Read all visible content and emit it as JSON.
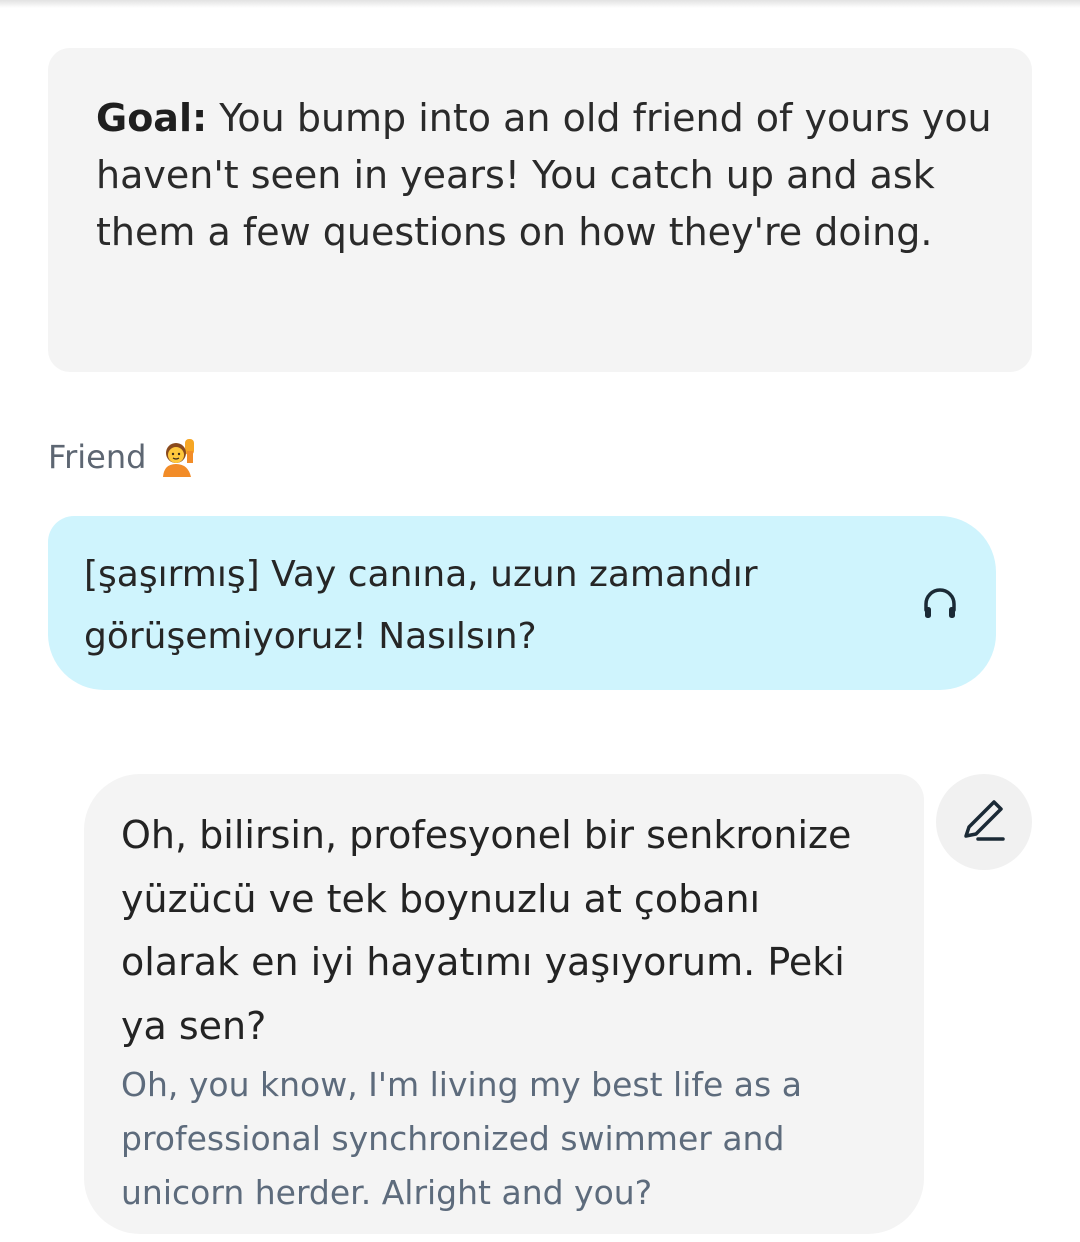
{
  "goal": {
    "label": "Goal:",
    "text": " You bump into an old friend of yours you haven't seen in years! You catch up and ask them a few questions on how they're doing."
  },
  "speaker": {
    "name": "Friend",
    "avatar_icon": "person-raising-hand-icon"
  },
  "friend_message": {
    "text": "[şaşırmış] Vay canına, uzun zamandır görüşemiyoruz! Nasılsın?",
    "listen_icon": "headphones-icon"
  },
  "reply": {
    "text": "Oh, bilirsin, profesyonel bir senkronize yüzücü ve tek boynuzlu at çobanı olarak en iyi hayatımı yaşıyorum. Peki ya sen?",
    "translation": "Oh, you know, I'm living my best life as a professional synchronized swimmer and unicorn herder. Alright and you?",
    "edit_icon": "pencil-icon"
  },
  "colors": {
    "friend_bubble": "#cff4fd",
    "card_background": "#f4f4f4",
    "translation_text": "#5d6b7c",
    "speaker_text": "#5d6672"
  }
}
